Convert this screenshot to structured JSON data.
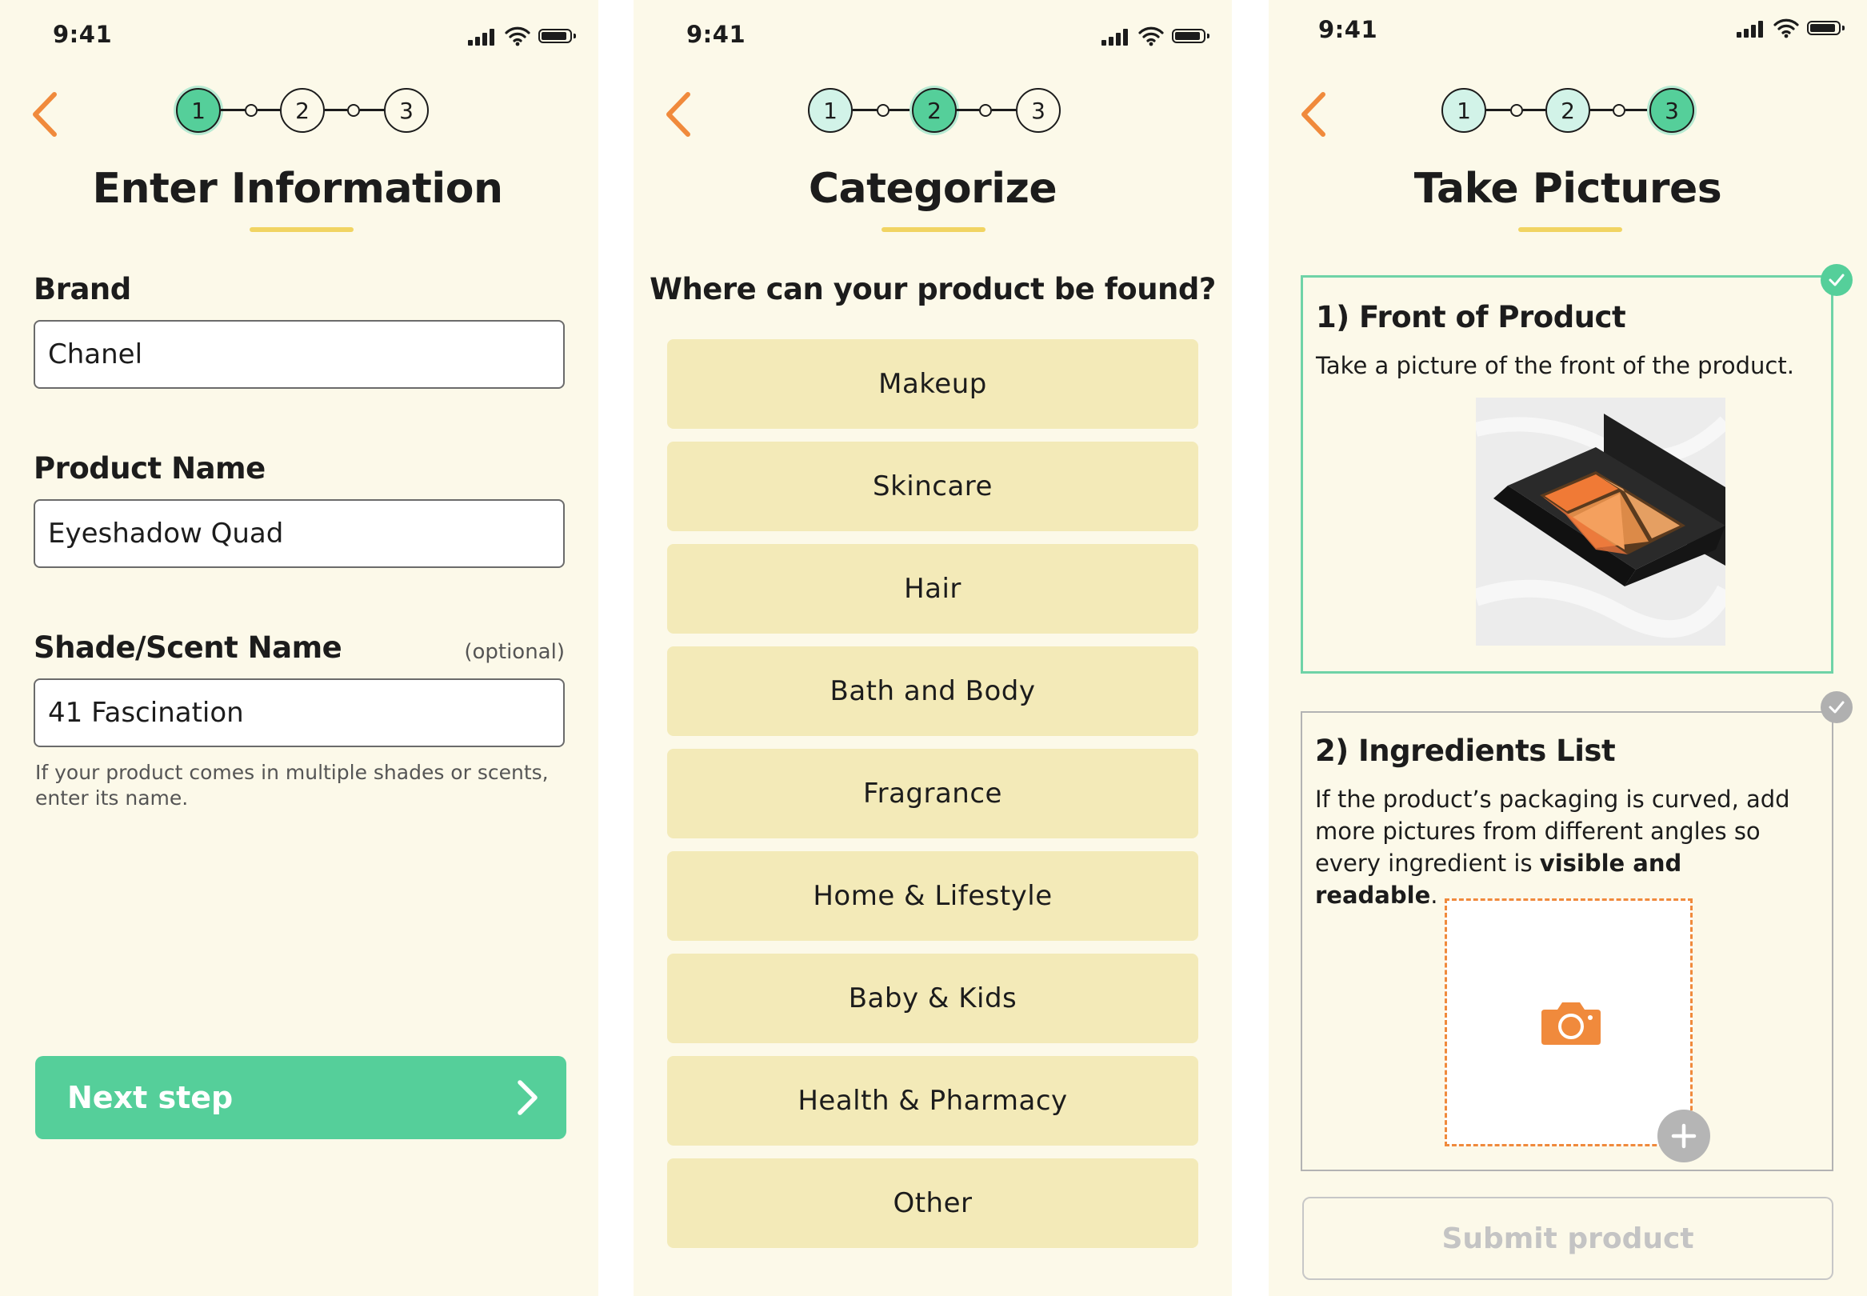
{
  "status_bar": {
    "time": "9:41"
  },
  "stepper": {
    "steps": [
      "1",
      "2",
      "3"
    ]
  },
  "screen1": {
    "title": "Enter Information",
    "brand_label": "Brand",
    "brand_value": "Chanel",
    "product_name_label": "Product Name",
    "product_name_value": "Eyeshadow Quad",
    "shade_label": "Shade/Scent Name",
    "shade_optional": "(optional)",
    "shade_value": "41 Fascination",
    "shade_hint": "If your product comes in multiple shades or scents, enter its name.",
    "next_button": "Next step",
    "current_step": 1
  },
  "screen2": {
    "title": "Categorize",
    "question": "Where can your product be found?",
    "categories": [
      "Makeup",
      "Skincare",
      "Hair",
      "Bath and Body",
      "Fragrance",
      "Home & Lifestyle",
      "Baby & Kids",
      "Health & Pharmacy",
      "Other"
    ],
    "current_step": 2
  },
  "screen3": {
    "title": "Take Pictures",
    "card1_title": "1) Front of Product",
    "card1_desc": "Take a picture of the front of the product.",
    "card2_title": "2) Ingredients List",
    "card2_desc_pre": "If the product’s packaging is curved, add more pictures from different angles so every ingredient is ",
    "card2_desc_bold": "visible and readable",
    "card2_desc_post": ".",
    "submit_button": "Submit product",
    "current_step": 3
  },
  "colors": {
    "background": "#fcf9e9",
    "accent_green": "#55cf9a",
    "accent_orange": "#f08a3c",
    "underline_yellow": "#f1d462",
    "category_fill": "#f3eab8"
  },
  "icons": [
    "back-chevron-icon",
    "signal-icon",
    "wifi-icon",
    "battery-icon",
    "chevron-right-icon",
    "check-icon",
    "camera-icon",
    "plus-icon"
  ]
}
